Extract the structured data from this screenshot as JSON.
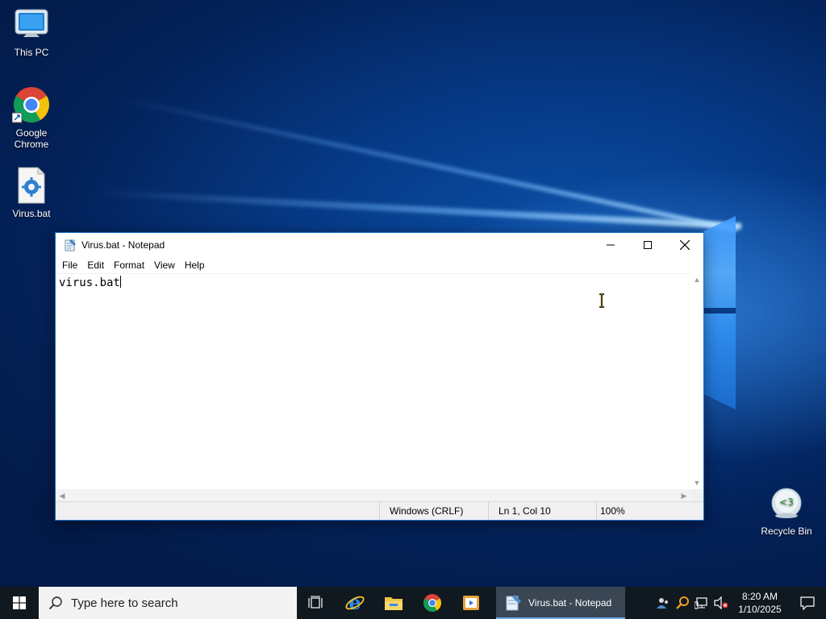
{
  "desktop": {
    "icons": [
      {
        "label": "This PC",
        "icon": "computer-icon"
      },
      {
        "label": "Google Chrome",
        "icon": "chrome-icon"
      },
      {
        "label": "Virus.bat",
        "icon": "batch-file-icon"
      },
      {
        "label": "Recycle Bin",
        "icon": "recycle-bin-icon"
      }
    ]
  },
  "notepad": {
    "title": "Virus.bat - Notepad",
    "menu": [
      "File",
      "Edit",
      "Format",
      "View",
      "Help"
    ],
    "content": "virus.bat",
    "status": {
      "line_ending": "Windows (CRLF)",
      "position": "Ln 1, Col 10",
      "zoom": "100%"
    },
    "controls": [
      "minimize-icon",
      "maximize-icon",
      "close-icon"
    ]
  },
  "taskbar": {
    "search_placeholder": "Type here to search",
    "pinned": [
      "task-view-icon",
      "internet-explorer-icon",
      "file-explorer-icon",
      "chrome-icon",
      "media-player-icon"
    ],
    "active_window_label": "Virus.bat - Notepad",
    "tray": [
      "people-icon",
      "search-tray-icon",
      "network-icon",
      "volume-muted-icon"
    ],
    "clock": {
      "time": "8:20 AM",
      "date": "1/10/2025"
    }
  },
  "colors": {
    "accent": "#1a6fc7",
    "taskbar": "#101820",
    "wallpaper": "#063a87"
  }
}
